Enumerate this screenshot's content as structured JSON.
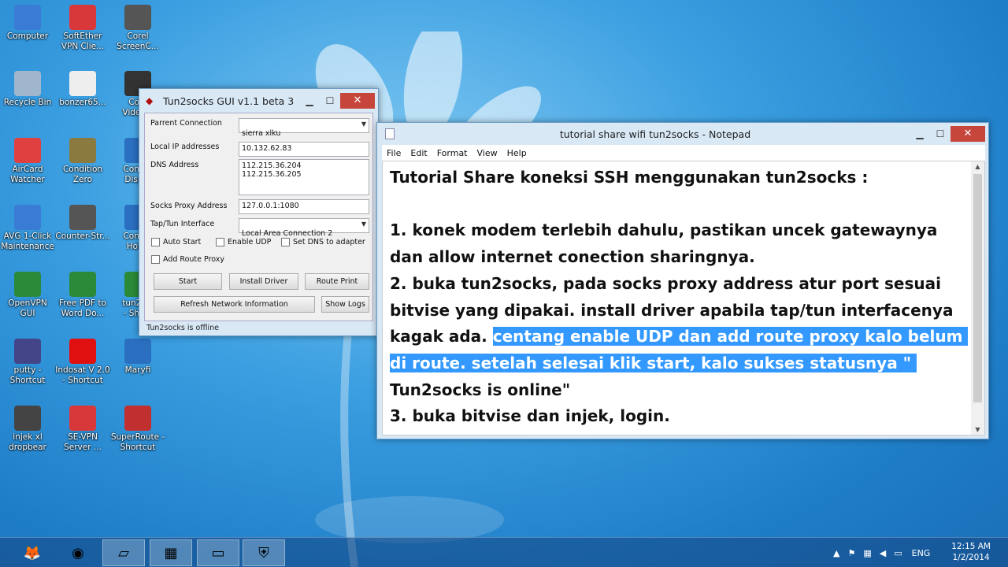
{
  "desktop_icons": [
    {
      "label": "Computer",
      "icon": "computer-icon",
      "color": "#3a7bd5"
    },
    {
      "label": "SoftEther\nVPN Clie...",
      "icon": "softether-icon",
      "color": "#d9383a"
    },
    {
      "label": "Corel\nScreenC...",
      "icon": "corel-icon",
      "color": "#555555"
    },
    {
      "label": "Recycle Bin",
      "icon": "recycle-bin-icon",
      "color": "#9fb6cc"
    },
    {
      "label": "bonzer65...",
      "icon": "file-icon",
      "color": "#eeeeee"
    },
    {
      "label": "Co...\nVideo...",
      "icon": "video-icon",
      "color": "#333333"
    },
    {
      "label": "AirCard\nWatcher",
      "icon": "aircard-icon",
      "color": "#e04040"
    },
    {
      "label": "Condition\nZero",
      "icon": "game-icon",
      "color": "#8a7a40"
    },
    {
      "label": "Conn...\nDisp...",
      "icon": "network-icon",
      "color": "#2a6fc0"
    },
    {
      "label": "AVG 1-Click\nMaintenance",
      "icon": "avg-icon",
      "color": "#3a7bd5"
    },
    {
      "label": "Counter-Str...",
      "icon": "game-icon",
      "color": "#555555"
    },
    {
      "label": "Conn...\nHot...",
      "icon": "wifi-icon",
      "color": "#2a6fc0"
    },
    {
      "label": "OpenVPN\nGUI",
      "icon": "openvpn-icon",
      "color": "#2b8a3a"
    },
    {
      "label": "Free PDF to\nWord Do...",
      "icon": "pdf-icon",
      "color": "#2b8a3a"
    },
    {
      "label": "tun2s...\n- Sho...",
      "icon": "shortcut-icon",
      "color": "#2b8a3a"
    },
    {
      "label": "putty -\nShortcut",
      "icon": "putty-icon",
      "color": "#444488"
    },
    {
      "label": "Indosat V 2.0\n- Shortcut",
      "icon": "indosat-icon",
      "color": "#e01010"
    },
    {
      "label": "Maryfi",
      "icon": "wifi-icon",
      "color": "#2a6fc0"
    },
    {
      "label": "injek xl\ndropbear",
      "icon": "gear-icon",
      "color": "#444444"
    },
    {
      "label": "SE-VPN\nServer ...",
      "icon": "sevpn-icon",
      "color": "#d9383a"
    },
    {
      "label": "SuperRoute -\nShortcut",
      "icon": "superroute-icon",
      "color": "#c03030"
    }
  ],
  "tun2socks": {
    "title": "Tun2socks GUI v1.1 beta 3",
    "labels": {
      "parent_connection": "Parrent Connection",
      "local_ip": "Local IP addresses",
      "dns": "DNS Address",
      "socks_proxy": "Socks Proxy Address",
      "tap_tun": "Tap/Tun Interface"
    },
    "values": {
      "parent_connection": "sierra xlku",
      "local_ip": "10.132.62.83",
      "dns": "112.215.36.204\n112.215.36.205",
      "socks_proxy": "127.0.0.1:1080",
      "tap_tun": "Local Area Connection 2"
    },
    "checkboxes": {
      "auto_start": "Auto Start",
      "enable_udp": "Enable UDP",
      "set_dns": "Set DNS to adapter",
      "add_route": "Add Route Proxy"
    },
    "buttons": {
      "start": "Start",
      "install_driver": "Install Driver",
      "route_print": "Route Print",
      "refresh": "Refresh Network Information",
      "show_logs": "Show Logs"
    },
    "status": "Tun2socks is offline",
    "min": "▭",
    "max": "☐",
    "close": "✕"
  },
  "notepad": {
    "title": "tutorial share wifi tun2socks - Notepad",
    "menu": [
      "File",
      "Edit",
      "Format",
      "View",
      "Help"
    ],
    "text_before": "Tutorial Share koneksi SSH menggunakan tun2socks :\n\n1. konek modem terlebih dahulu, pastikan uncek gatewaynya dan allow internet conection sharingnya.\n2. buka tun2socks, pada socks proxy address atur port sesuai bitvise yang dipakai. install driver apabila tap/tun interfacenya kagak ada. ",
    "text_selected": "centang enable UDP dan add route proxy kalo belum di route. setelah selesai klik start, kalo sukses statusnya \" ",
    "text_after": "Tun2socks is online\"\n3. buka bitvise dan injek, login."
  },
  "taskbar": {
    "apps": [
      {
        "name": "firefox-icon",
        "glyph": "🦊"
      },
      {
        "name": "chrome-icon",
        "glyph": "◉"
      },
      {
        "name": "notepad-icon",
        "glyph": "▱"
      },
      {
        "name": "video-editor-icon",
        "glyph": "▦"
      },
      {
        "name": "remote-desktop-icon",
        "glyph": "▭"
      },
      {
        "name": "shield-icon",
        "glyph": "⛨"
      }
    ],
    "lang": "ENG",
    "time": "12:15 AM",
    "date": "1/2/2014"
  }
}
